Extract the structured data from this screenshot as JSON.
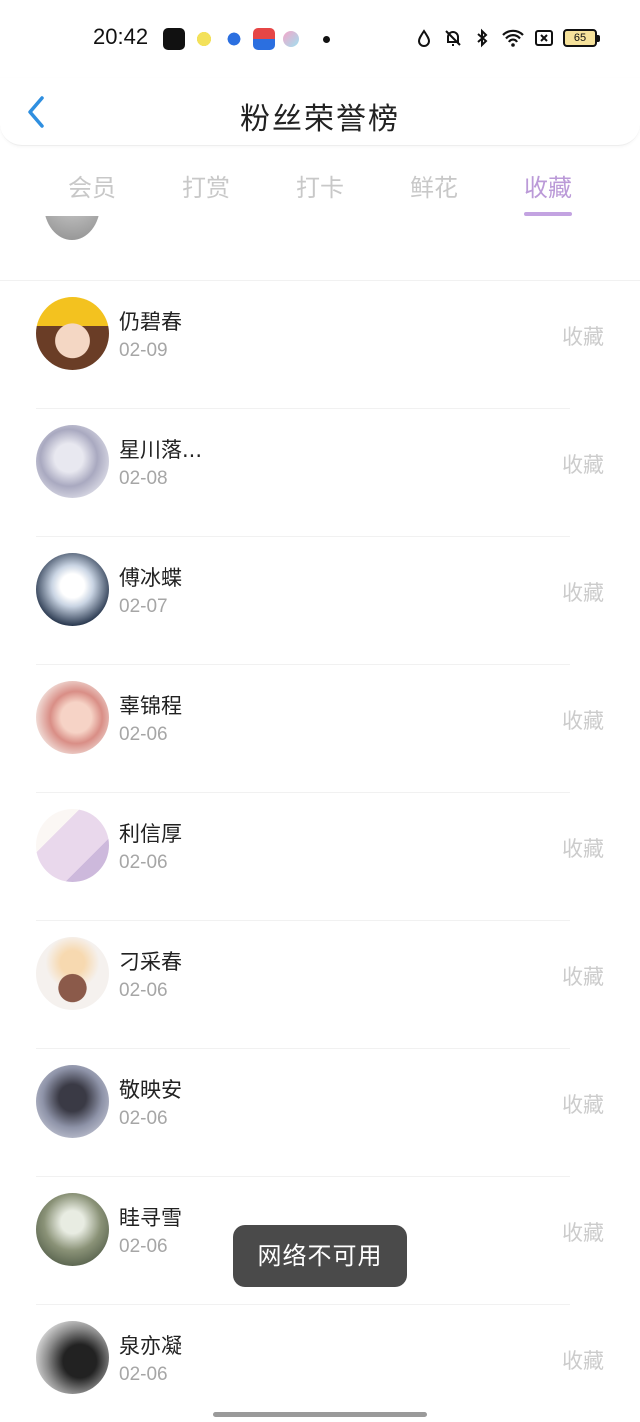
{
  "status_bar": {
    "time": "20:42",
    "battery": "65",
    "app_icons": [
      "capcut-icon",
      "qq-icon",
      "baidu-icon",
      "baidu-netdisk-icon",
      "bubble-icon",
      "dot-icon"
    ],
    "system_icons": [
      "nfc-icon",
      "mute-icon",
      "bluetooth-icon",
      "wifi-icon",
      "no-sim-icon"
    ]
  },
  "header": {
    "title": "粉丝荣誉榜",
    "back_icon": "chevron-left-icon"
  },
  "tabs": [
    {
      "label": "会员",
      "active": false
    },
    {
      "label": "打赏",
      "active": false
    },
    {
      "label": "打卡",
      "active": false
    },
    {
      "label": "鲜花",
      "active": false
    },
    {
      "label": "收藏",
      "active": true
    }
  ],
  "fans": [
    {
      "name": "仍碧春",
      "date": "02-09",
      "action": "收藏"
    },
    {
      "name": "星川落...",
      "date": "02-08",
      "action": "收藏"
    },
    {
      "name": "傅冰蝶",
      "date": "02-07",
      "action": "收藏"
    },
    {
      "name": "辜锦程",
      "date": "02-06",
      "action": "收藏"
    },
    {
      "name": "利信厚",
      "date": "02-06",
      "action": "收藏"
    },
    {
      "name": "刁采春",
      "date": "02-06",
      "action": "收藏"
    },
    {
      "name": "敬映安",
      "date": "02-06",
      "action": "收藏"
    },
    {
      "name": "眭寻雪",
      "date": "02-06",
      "action": "收藏"
    },
    {
      "name": "泉亦凝",
      "date": "02-06",
      "action": "收藏"
    }
  ],
  "toast": {
    "message": "网络不可用"
  },
  "colors": {
    "accent": "#bb9ad8",
    "indicator": "#c3a3e1",
    "back_arrow": "#2f8fe0",
    "inactive_tab": "#c8c8c8",
    "toast_bg": "#4a4a4a"
  }
}
